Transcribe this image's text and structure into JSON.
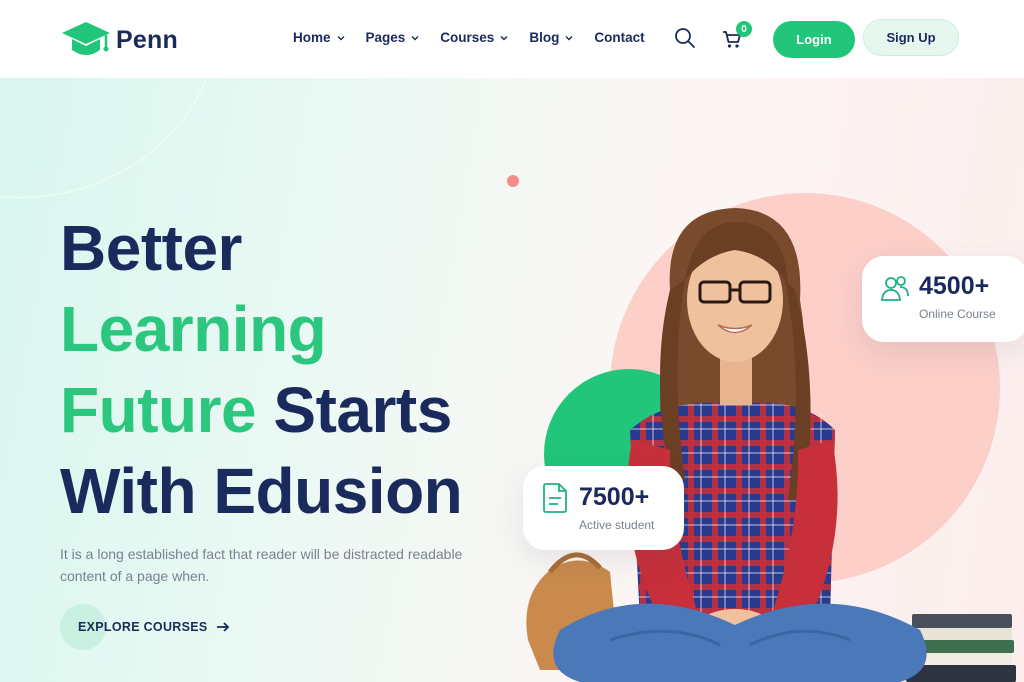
{
  "brand": {
    "name": "Penn"
  },
  "nav": {
    "items": [
      {
        "label": "Home",
        "dropdown": true
      },
      {
        "label": "Pages",
        "dropdown": true
      },
      {
        "label": "Courses",
        "dropdown": true
      },
      {
        "label": "Blog",
        "dropdown": true
      },
      {
        "label": "Contact",
        "dropdown": false
      }
    ]
  },
  "header": {
    "cart_count": "0",
    "login_label": "Login",
    "signup_label": "Sign Up"
  },
  "hero": {
    "headline_line1": "Better",
    "headline_line2": "Learning",
    "headline_line3_green": "Future",
    "headline_line3_dark": " Starts",
    "headline_line4": "With Edusion",
    "description": "It is a long established fact that reader will be distracted readable content of a page when.",
    "cta_label": "EXPLORE COURSES"
  },
  "stats": {
    "courses": {
      "value": "4500+",
      "label": "Online Course"
    },
    "students": {
      "value": "7500+",
      "label": "Active student"
    }
  },
  "colors": {
    "primary_green": "#21c67a",
    "navy": "#1b2a5c",
    "pink": "#fccfc9",
    "text_gray": "#7a8191"
  },
  "icons": {
    "search": "search-icon",
    "cart": "cart-icon",
    "courses": "users-icon",
    "students": "document-icon"
  }
}
